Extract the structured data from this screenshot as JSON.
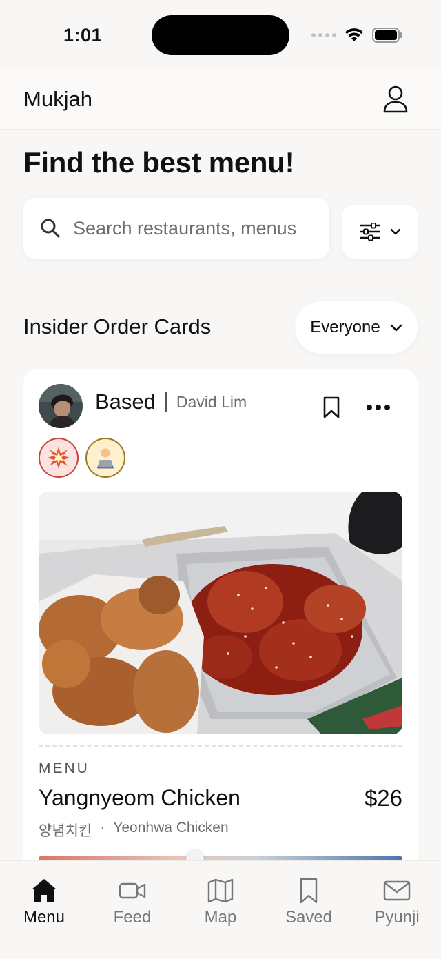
{
  "status_bar": {
    "time": "1:01"
  },
  "header": {
    "app_title": "Mukjah"
  },
  "headline": "Find the best menu!",
  "search": {
    "placeholder": "Search restaurants, menus"
  },
  "section": {
    "title": "Insider Order Cards",
    "audience": "Everyone"
  },
  "card": {
    "author_name": "Based",
    "author_handle": "David Lim",
    "badges": [
      "💥",
      "🧑‍💻"
    ],
    "menu_label": "MENU",
    "menu_name": "Yangnyeom Chicken",
    "menu_price": "$26",
    "menu_name_korean": "양념치킨",
    "separator": "·",
    "restaurant": "Yeonhwa Chicken",
    "rating_position": 0.43
  },
  "tabs": [
    {
      "label": "Menu",
      "icon": "home-icon",
      "active": true
    },
    {
      "label": "Feed",
      "icon": "video-icon",
      "active": false
    },
    {
      "label": "Map",
      "icon": "map-icon",
      "active": false
    },
    {
      "label": "Saved",
      "icon": "bookmark-icon",
      "active": false
    },
    {
      "label": "Pyunji",
      "icon": "mail-icon",
      "active": false
    }
  ],
  "colors": {
    "background": "#f8f7f5",
    "card": "#ffffff",
    "text": "#111111",
    "muted": "#6d6d6d"
  }
}
